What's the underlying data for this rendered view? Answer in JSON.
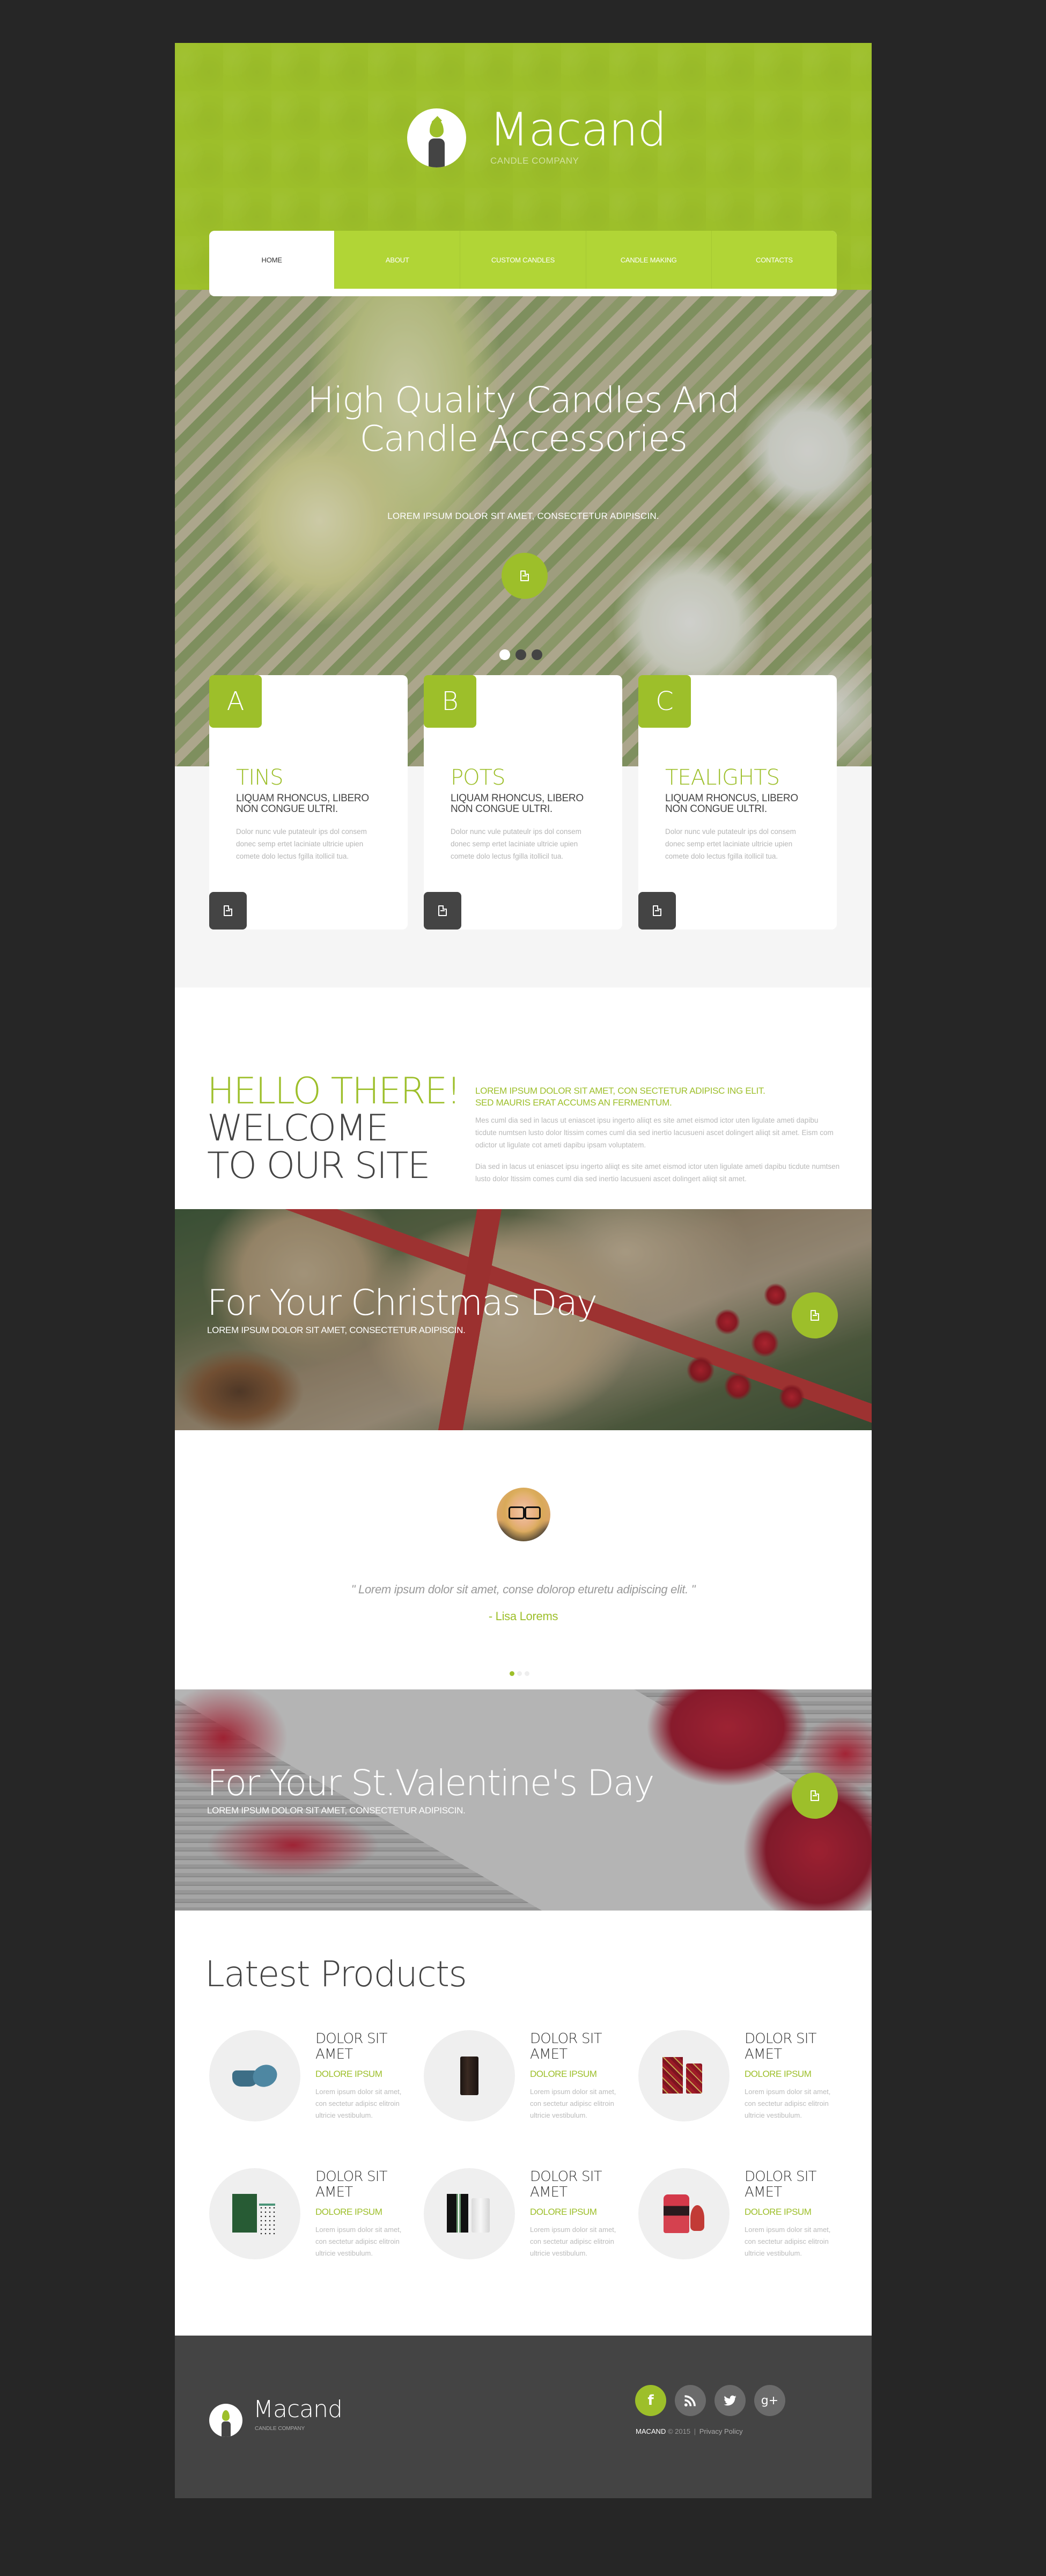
{
  "colors": {
    "accent": "#9dbf2a",
    "nav": "#b1d536",
    "dark": "#444444",
    "page_bg": "#262626"
  },
  "header": {
    "brand": "Macand",
    "tagline": "CANDLE COMPANY",
    "logo_icon": "candle-icon"
  },
  "nav": {
    "items": [
      {
        "label": "HOME",
        "active": true
      },
      {
        "label": "ABOUT",
        "active": false
      },
      {
        "label": "CUSTOM CANDLES",
        "active": false
      },
      {
        "label": "CANDLE MAKING",
        "active": false
      },
      {
        "label": "CONTACTS",
        "active": false
      }
    ]
  },
  "hero": {
    "title_line1": "High Quality Candles And",
    "title_line2": "Candle Accessories",
    "subtitle": "LOREM IPSUM DOLOR SIT AMET, CONSECTETUR ADIPISCIN.",
    "button_icon": "document-icon",
    "slides": 3,
    "active_slide": 1
  },
  "features": [
    {
      "letter": "A",
      "title": "TINS",
      "subtitle": "LIQUAM RHONCUS, LIBERO NON CONGUE ULTRI.",
      "text": "Dolor nunc vule putateulr ips dol consem donec semp ertet laciniate ultricie upien comete dolo lectus fgilla itollicil tua.",
      "button_icon": "document-icon"
    },
    {
      "letter": "B",
      "title": "POTS",
      "subtitle": "LIQUAM RHONCUS, LIBERO NON CONGUE ULTRI.",
      "text": "Dolor nunc vule putateulr ips dol consem donec semp ertet laciniate ultricie upien comete dolo lectus fgilla itollicil tua.",
      "button_icon": "document-icon"
    },
    {
      "letter": "C",
      "title": "TEALIGHTS",
      "subtitle": "LIQUAM RHONCUS, LIBERO NON CONGUE ULTRI.",
      "text": "Dolor nunc vule putateulr ips dol consem donec semp ertet laciniate ultricie upien comete dolo lectus fgilla itollicil tua.",
      "button_icon": "document-icon"
    }
  ],
  "welcome": {
    "heading_accent": "HELLO THERE!",
    "heading_line2": "WELCOME",
    "heading_line3": "TO OUR SITE",
    "lead_line1": "LOREM IPSUM DOLOR SIT AMET, CON SECTETUR ADIPISC ING ELIT.",
    "lead_line2": "SED MAURIS ERAT ACCUMS AN FERMENTUM.",
    "paragraph1": "Mes cuml dia sed in lacus ut eniascet ipsu ingerto aliiqt es site amet eismod ictor uten ligulate ameti dapibu ticdute numtsen lusto dolor ltissim comes cuml dia sed inertio lacusueni ascet dolingert aliiqt sit amet. Eism com odictor ut ligulate cot ameti dapibu ipsam voluptatem.",
    "paragraph2": "Dia sed in lacus ut eniascet ipsu ingerto aliiqt es site amet eismod ictor uten ligulate ameti dapibu ticdute numtsen lusto dolor ltissim comes cuml dia sed inertio lacusueni ascet dolingert aliiqt sit amet."
  },
  "banners": [
    {
      "title": "For Your Christmas Day",
      "subtitle": "LOREM IPSUM DOLOR SIT AMET, CONSECTETUR ADIPISCIN.",
      "button_icon": "document-icon"
    },
    {
      "title": "For Your St.Valentine's Day",
      "subtitle": "LOREM IPSUM DOLOR SIT AMET, CONSECTETUR ADIPISCIN.",
      "button_icon": "document-icon"
    }
  ],
  "testimonial": {
    "quote": "\" Lorem ipsum dolor sit amet, conse dolorop eturetu adipiscing elit. \"",
    "author": "- Lisa Lorems",
    "slides": 3,
    "active_slide": 1
  },
  "products": {
    "title": "Latest Products",
    "items": [
      {
        "name": "DOLOR SIT AMET",
        "category": "DOLORE IPSUM",
        "description": "Lorem ipsum dolor sit amet, con sectetur adipisc elitroin ultricie vestibulum.",
        "image": "blue-tin-candle"
      },
      {
        "name": "DOLOR SIT AMET",
        "category": "DOLORE IPSUM",
        "description": "Lorem ipsum dolor sit amet, con sectetur adipisc elitroin ultricie vestibulum.",
        "image": "black-jar-candle"
      },
      {
        "name": "DOLOR SIT AMET",
        "category": "DOLORE IPSUM",
        "description": "Lorem ipsum dolor sit amet, con sectetur adipisc elitroin ultricie vestibulum.",
        "image": "red-patterned-candle-box"
      },
      {
        "name": "DOLOR SIT AMET",
        "category": "DOLORE IPSUM",
        "description": "Lorem ipsum dolor sit amet, con sectetur adipisc elitroin ultricie vestibulum.",
        "image": "green-box-candle"
      },
      {
        "name": "DOLOR SIT AMET",
        "category": "DOLORE IPSUM",
        "description": "Lorem ipsum dolor sit amet, con sectetur adipisc elitroin ultricie vestibulum.",
        "image": "nest-candle"
      },
      {
        "name": "DOLOR SIT AMET",
        "category": "DOLORE IPSUM",
        "description": "Lorem ipsum dolor sit amet, con sectetur adipisc elitroin ultricie vestibulum.",
        "image": "red-gift-candle"
      }
    ]
  },
  "footer": {
    "brand": "Macand",
    "tagline": "CANDLE COMPANY",
    "socials": [
      {
        "name": "facebook",
        "icon": "facebook-icon",
        "glyph": "f"
      },
      {
        "name": "rss",
        "icon": "rss-icon",
        "glyph": ""
      },
      {
        "name": "twitter",
        "icon": "twitter-icon",
        "glyph": ""
      },
      {
        "name": "google-plus",
        "icon": "google-plus-icon",
        "glyph": "g+"
      }
    ],
    "copyright_brand": "MACAND",
    "copyright_text": "© 2015",
    "separator": "|",
    "privacy_label": "Privacy Policy"
  }
}
